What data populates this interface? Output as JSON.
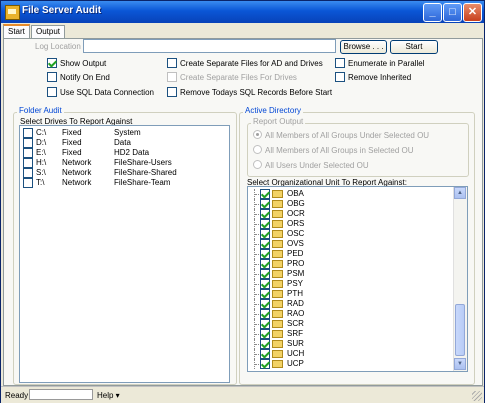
{
  "window": {
    "title": "File Server Audit",
    "buttons": {
      "minimize": "_",
      "maximize": "□",
      "close": "✕"
    }
  },
  "tabs": [
    {
      "label": "Start",
      "active": true
    },
    {
      "label": "Output",
      "active": false
    }
  ],
  "top": {
    "log_location_label": "Log Location",
    "log_location_value": "",
    "browse_label": "Browse . . .",
    "start_label": "Start"
  },
  "options": {
    "show_output": {
      "label": "Show Output",
      "checked": true
    },
    "notify_on_end": {
      "label": "Notify On End",
      "checked": false
    },
    "use_sql": {
      "label": "Use SQL Data Connection",
      "checked": false
    },
    "separate_ad": {
      "label": "Create Separate Files for AD and Drives",
      "checked": false
    },
    "separate_drives": {
      "label": "Create Separate Files For Drives",
      "checked": false,
      "disabled": true
    },
    "remove_sql": {
      "label": "Remove Todays SQL Records Before Start",
      "checked": false
    },
    "enumerate_parallel": {
      "label": "Enumerate in Parallel",
      "checked": false
    },
    "remove_inherited": {
      "label": "Remove Inherited",
      "checked": false
    }
  },
  "folder_audit": {
    "group_label": "Folder Audit",
    "list_label": "Select Drives To Report Against",
    "drives": [
      {
        "drive": "C:\\",
        "type": "Fixed",
        "name": "System"
      },
      {
        "drive": "D:\\",
        "type": "Fixed",
        "name": "Data"
      },
      {
        "drive": "E:\\",
        "type": "Fixed",
        "name": "HD2 Data"
      },
      {
        "drive": "H:\\",
        "type": "Network",
        "name": "FileShare-Users"
      },
      {
        "drive": "S:\\",
        "type": "Network",
        "name": "FileShare-Shared"
      },
      {
        "drive": "T:\\",
        "type": "Network",
        "name": "FileShare-Team"
      }
    ]
  },
  "active_directory": {
    "group_label": "Active Directory",
    "report_output_label": "Report Output",
    "radios": [
      {
        "label": "All Members of All Groups Under Selected OU",
        "selected": true
      },
      {
        "label": "All Members of All Groups in Selected OU",
        "selected": false
      },
      {
        "label": "All Users Under Selected OU",
        "selected": false
      }
    ],
    "ou_list_label": "Select Organizational Unit To Report Against:",
    "ous": [
      "OBA",
      "OBG",
      "OCR",
      "ORS",
      "OSC",
      "OVS",
      "PED",
      "PRO",
      "PSM",
      "PSY",
      "PTH",
      "RAD",
      "RAO",
      "SCR",
      "SRF",
      "SUR",
      "UCH",
      "UCP"
    ]
  },
  "status": {
    "ready": "Ready",
    "help": "Help ▾"
  },
  "colors": {
    "title_bar": "#0a56d6",
    "group_label": "#0046d5",
    "check": "#21a121"
  }
}
